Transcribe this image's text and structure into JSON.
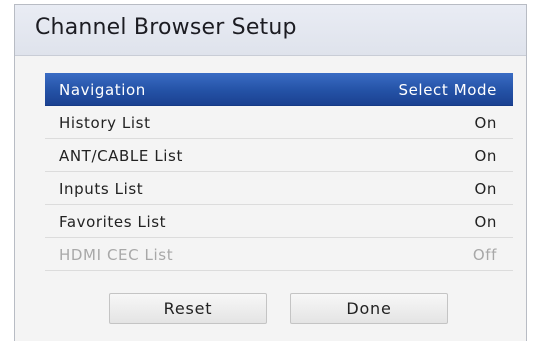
{
  "dialog": {
    "title": "Channel Browser Setup"
  },
  "menu": {
    "items": [
      {
        "label": "Navigation",
        "value": "Select Mode",
        "state": "selected"
      },
      {
        "label": "History List",
        "value": "On",
        "state": "normal"
      },
      {
        "label": "ANT/CABLE List",
        "value": "On",
        "state": "normal"
      },
      {
        "label": "Inputs List",
        "value": "On",
        "state": "normal"
      },
      {
        "label": "Favorites List",
        "value": "On",
        "state": "normal"
      },
      {
        "label": "HDMI CEC List",
        "value": "Off",
        "state": "disabled"
      }
    ]
  },
  "buttons": {
    "reset_label": "Reset",
    "done_label": "Done"
  },
  "colors": {
    "selection": "#2452a6",
    "title_bar": "#e3e6ef",
    "disabled_text": "#a8a8a8"
  }
}
